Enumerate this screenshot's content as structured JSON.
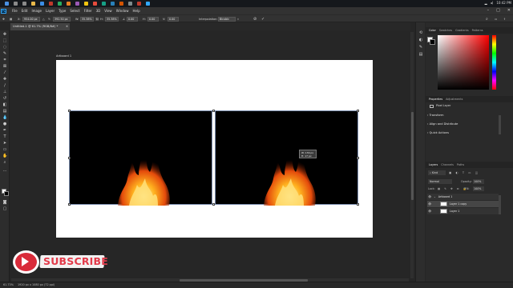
{
  "taskbar": {
    "icons": [
      {
        "name": "start-icon",
        "color": "#4a90e2"
      },
      {
        "name": "search-icon",
        "color": "#8a8a8a"
      },
      {
        "name": "task-view-icon",
        "color": "#8a8a8a"
      },
      {
        "name": "file-explorer-icon",
        "color": "#e8b84a"
      },
      {
        "name": "browser-icon",
        "color": "#3c8ee6"
      },
      {
        "name": "app-icon",
        "color": "#c0392b"
      },
      {
        "name": "app-icon",
        "color": "#27ae60"
      },
      {
        "name": "app-icon",
        "color": "#e67e22"
      },
      {
        "name": "app-icon",
        "color": "#9b59b6"
      },
      {
        "name": "app-icon",
        "color": "#f1c40f"
      },
      {
        "name": "app-icon",
        "color": "#e74c3c"
      },
      {
        "name": "app-icon",
        "color": "#16a085"
      },
      {
        "name": "app-icon",
        "color": "#2980b9"
      },
      {
        "name": "app-icon",
        "color": "#d35400"
      },
      {
        "name": "app-icon",
        "color": "#7f8c8d"
      },
      {
        "name": "app-icon",
        "color": "#c0392b"
      },
      {
        "name": "photoshop-icon",
        "color": "#31a8ff"
      }
    ],
    "clock": "10:42 PM"
  },
  "menubar": {
    "logo": "Ps",
    "items": [
      "File",
      "Edit",
      "Image",
      "Layer",
      "Type",
      "Select",
      "Filter",
      "3D",
      "View",
      "Window",
      "Help"
    ],
    "window_controls": [
      "–",
      "□",
      "✕"
    ]
  },
  "options": {
    "x_label": "X:",
    "x_value": "954.00 px",
    "y_label": "Y:",
    "y_value": "392.50 px",
    "w_label": "W:",
    "w_value": "35.38%",
    "h_label": "H:",
    "h_value": "35.38%",
    "angle_label": "∠",
    "angle_value": "0.00",
    "hskew_label": "H:",
    "hskew_value": "0.00",
    "vskew_label": "V:",
    "vskew_value": "0.00",
    "interp_label": "Interpolation:",
    "interp_value": "Bicubic"
  },
  "document": {
    "tab_title": "Untitled-1 @ 61.7% (RGB/8#) *",
    "artboard_label": "Artboard 1",
    "measure_line1": "W: 139 px",
    "measure_line2": "H: 17 px"
  },
  "right_panel": {
    "color_tabs": [
      "Color",
      "Swatches",
      "Gradients",
      "Patterns"
    ],
    "properties_tabs": [
      "Properties",
      "Adjustments"
    ],
    "pixel_layer_label": "Pixel Layer",
    "sections": [
      "Transform",
      "Align and Distribute",
      "Quick Actions"
    ],
    "layers_tabs": [
      "Layers",
      "Channels",
      "Paths"
    ],
    "kind_label": "Kind",
    "blend_mode": "Normal",
    "opacity_label": "Opacity:",
    "opacity_value": "100%",
    "lock_label": "Lock:",
    "fill_label": "Fill:",
    "fill_value": "100%",
    "layers": [
      {
        "name": "Artboard 1",
        "type": "artboard"
      },
      {
        "name": "Layer 1 copy",
        "type": "pixel"
      },
      {
        "name": "Layer 1",
        "type": "pixel"
      }
    ]
  },
  "statusbar": {
    "zoom": "61.73%",
    "doc_info": "1920 px x 1080 px (72 ppi)"
  },
  "subscribe": {
    "label": "SUBSCRIBE",
    "button_color": "#d92b3a",
    "text_color": "#e23b4a"
  },
  "colors": {
    "fg": "#ffffff",
    "bg": "#000000",
    "hue_marker": "#ff0000"
  }
}
